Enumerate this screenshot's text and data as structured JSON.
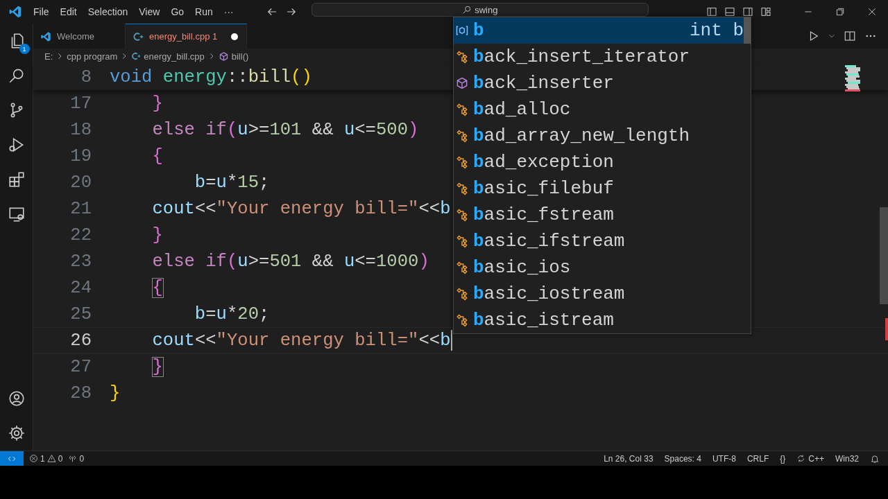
{
  "title_bar": {
    "menus": [
      "File",
      "Edit",
      "Selection",
      "View",
      "Go",
      "Run"
    ],
    "more": "···",
    "search": "swing"
  },
  "activity_bar": {
    "explorer_badge": "1"
  },
  "tabs": [
    {
      "label": "Welcome",
      "kind": "welcome",
      "selected": false,
      "modified": false,
      "error": false
    },
    {
      "label": "energy_bill.cpp 1",
      "kind": "cpp",
      "selected": true,
      "modified": true,
      "error": true
    }
  ],
  "breadcrumb": [
    {
      "label": "E:",
      "kind": "folder"
    },
    {
      "label": "cpp program",
      "kind": "folder"
    },
    {
      "label": "energy_bill.cpp",
      "kind": "cpp"
    },
    {
      "label": "bill()",
      "kind": "method"
    }
  ],
  "editor": {
    "sticky": {
      "number": "8",
      "tokens": [
        {
          "text": "void",
          "kind": "keyword"
        },
        {
          "text": " energy",
          "kind": "type"
        },
        {
          "text": "::",
          "kind": "plain"
        },
        {
          "text": "bill",
          "kind": "function"
        },
        {
          "text": "()",
          "kind": "bracket1"
        }
      ]
    },
    "lines": [
      {
        "number": "17",
        "current": false,
        "tokens": [
          {
            "text": "    }",
            "kind": "bracket2"
          }
        ]
      },
      {
        "number": "18",
        "current": false,
        "tokens": [
          {
            "text": "    else if",
            "kind": "control"
          },
          {
            "text": "(",
            "kind": "bracket2"
          },
          {
            "text": "u",
            "kind": "variable"
          },
          {
            "text": ">=",
            "kind": "plain"
          },
          {
            "text": "101",
            "kind": "number"
          },
          {
            "text": " && ",
            "kind": "plain"
          },
          {
            "text": "u",
            "kind": "variable"
          },
          {
            "text": "<=",
            "kind": "plain"
          },
          {
            "text": "500",
            "kind": "number"
          },
          {
            "text": ")",
            "kind": "bracket2"
          }
        ]
      },
      {
        "number": "19",
        "current": false,
        "tokens": [
          {
            "text": "    {",
            "kind": "bracket2"
          }
        ]
      },
      {
        "number": "20",
        "current": false,
        "tokens": [
          {
            "text": "        b",
            "kind": "variable"
          },
          {
            "text": "=",
            "kind": "plain"
          },
          {
            "text": "u",
            "kind": "variable"
          },
          {
            "text": "*",
            "kind": "plain"
          },
          {
            "text": "15",
            "kind": "number"
          },
          {
            "text": ";",
            "kind": "plain"
          }
        ]
      },
      {
        "number": "21",
        "current": false,
        "tokens": [
          {
            "text": "    cout",
            "kind": "variable"
          },
          {
            "text": "<<",
            "kind": "plain"
          },
          {
            "text": "\"Your energy bill=\"",
            "kind": "string"
          },
          {
            "text": "<<",
            "kind": "plain"
          },
          {
            "text": "b",
            "kind": "variable"
          }
        ]
      },
      {
        "number": "22",
        "current": false,
        "tokens": [
          {
            "text": "    }",
            "kind": "bracket2"
          }
        ]
      },
      {
        "number": "23",
        "current": false,
        "tokens": [
          {
            "text": "    else if",
            "kind": "control"
          },
          {
            "text": "(",
            "kind": "bracket2"
          },
          {
            "text": "u",
            "kind": "variable"
          },
          {
            "text": ">=",
            "kind": "plain"
          },
          {
            "text": "501",
            "kind": "number"
          },
          {
            "text": " && ",
            "kind": "plain"
          },
          {
            "text": "u",
            "kind": "variable"
          },
          {
            "text": "<=",
            "kind": "plain"
          },
          {
            "text": "1000",
            "kind": "number"
          },
          {
            "text": ")",
            "kind": "bracket2"
          }
        ]
      },
      {
        "number": "24",
        "current": false,
        "tokens": [
          {
            "text": "    {",
            "kind": "bracket_match"
          }
        ]
      },
      {
        "number": "25",
        "current": false,
        "tokens": [
          {
            "text": "        b",
            "kind": "variable"
          },
          {
            "text": "=",
            "kind": "plain"
          },
          {
            "text": "u",
            "kind": "variable"
          },
          {
            "text": "*",
            "kind": "plain"
          },
          {
            "text": "20",
            "kind": "number"
          },
          {
            "text": ";",
            "kind": "plain"
          }
        ]
      },
      {
        "number": "26",
        "current": true,
        "tokens": [
          {
            "text": "    cout",
            "kind": "variable"
          },
          {
            "text": "<<",
            "kind": "plain"
          },
          {
            "text": "\"Your energy bill=\"",
            "kind": "string"
          },
          {
            "text": "<<",
            "kind": "plain"
          },
          {
            "text": "b",
            "kind": "variable"
          }
        ]
      },
      {
        "number": "27",
        "current": false,
        "tokens": [
          {
            "text": "    }",
            "kind": "bracket_match"
          }
        ]
      },
      {
        "number": "28",
        "current": false,
        "tokens": [
          {
            "text": "}",
            "kind": "bracket1"
          }
        ]
      }
    ]
  },
  "suggest": {
    "items": [
      {
        "label": "b",
        "kind": "variable",
        "detail": "int b",
        "selected": true
      },
      {
        "label": "back_insert_iterator",
        "kind": "class",
        "selected": false
      },
      {
        "label": "back_inserter",
        "kind": "function",
        "selected": false
      },
      {
        "label": "bad_alloc",
        "kind": "class",
        "selected": false
      },
      {
        "label": "bad_array_new_length",
        "kind": "class",
        "selected": false
      },
      {
        "label": "bad_exception",
        "kind": "class",
        "selected": false
      },
      {
        "label": "basic_filebuf",
        "kind": "class",
        "selected": false
      },
      {
        "label": "basic_fstream",
        "kind": "class",
        "selected": false
      },
      {
        "label": "basic_ifstream",
        "kind": "class",
        "selected": false
      },
      {
        "label": "basic_ios",
        "kind": "class",
        "selected": false
      },
      {
        "label": "basic_iostream",
        "kind": "class",
        "selected": false
      },
      {
        "label": "basic_istream",
        "kind": "class",
        "selected": false
      }
    ]
  },
  "status_bar": {
    "errors": "1",
    "warnings": "0",
    "ports": "0",
    "items": [
      {
        "label": "Ln 26, Col 33",
        "kind": "text"
      },
      {
        "label": "Spaces: 4",
        "kind": "text"
      },
      {
        "label": "UTF-8",
        "kind": "text"
      },
      {
        "label": "CRLF",
        "kind": "text"
      },
      {
        "label": "{}",
        "kind": "text"
      },
      {
        "label": "C++",
        "kind": "language"
      },
      {
        "label": "Win32",
        "kind": "text"
      }
    ]
  }
}
